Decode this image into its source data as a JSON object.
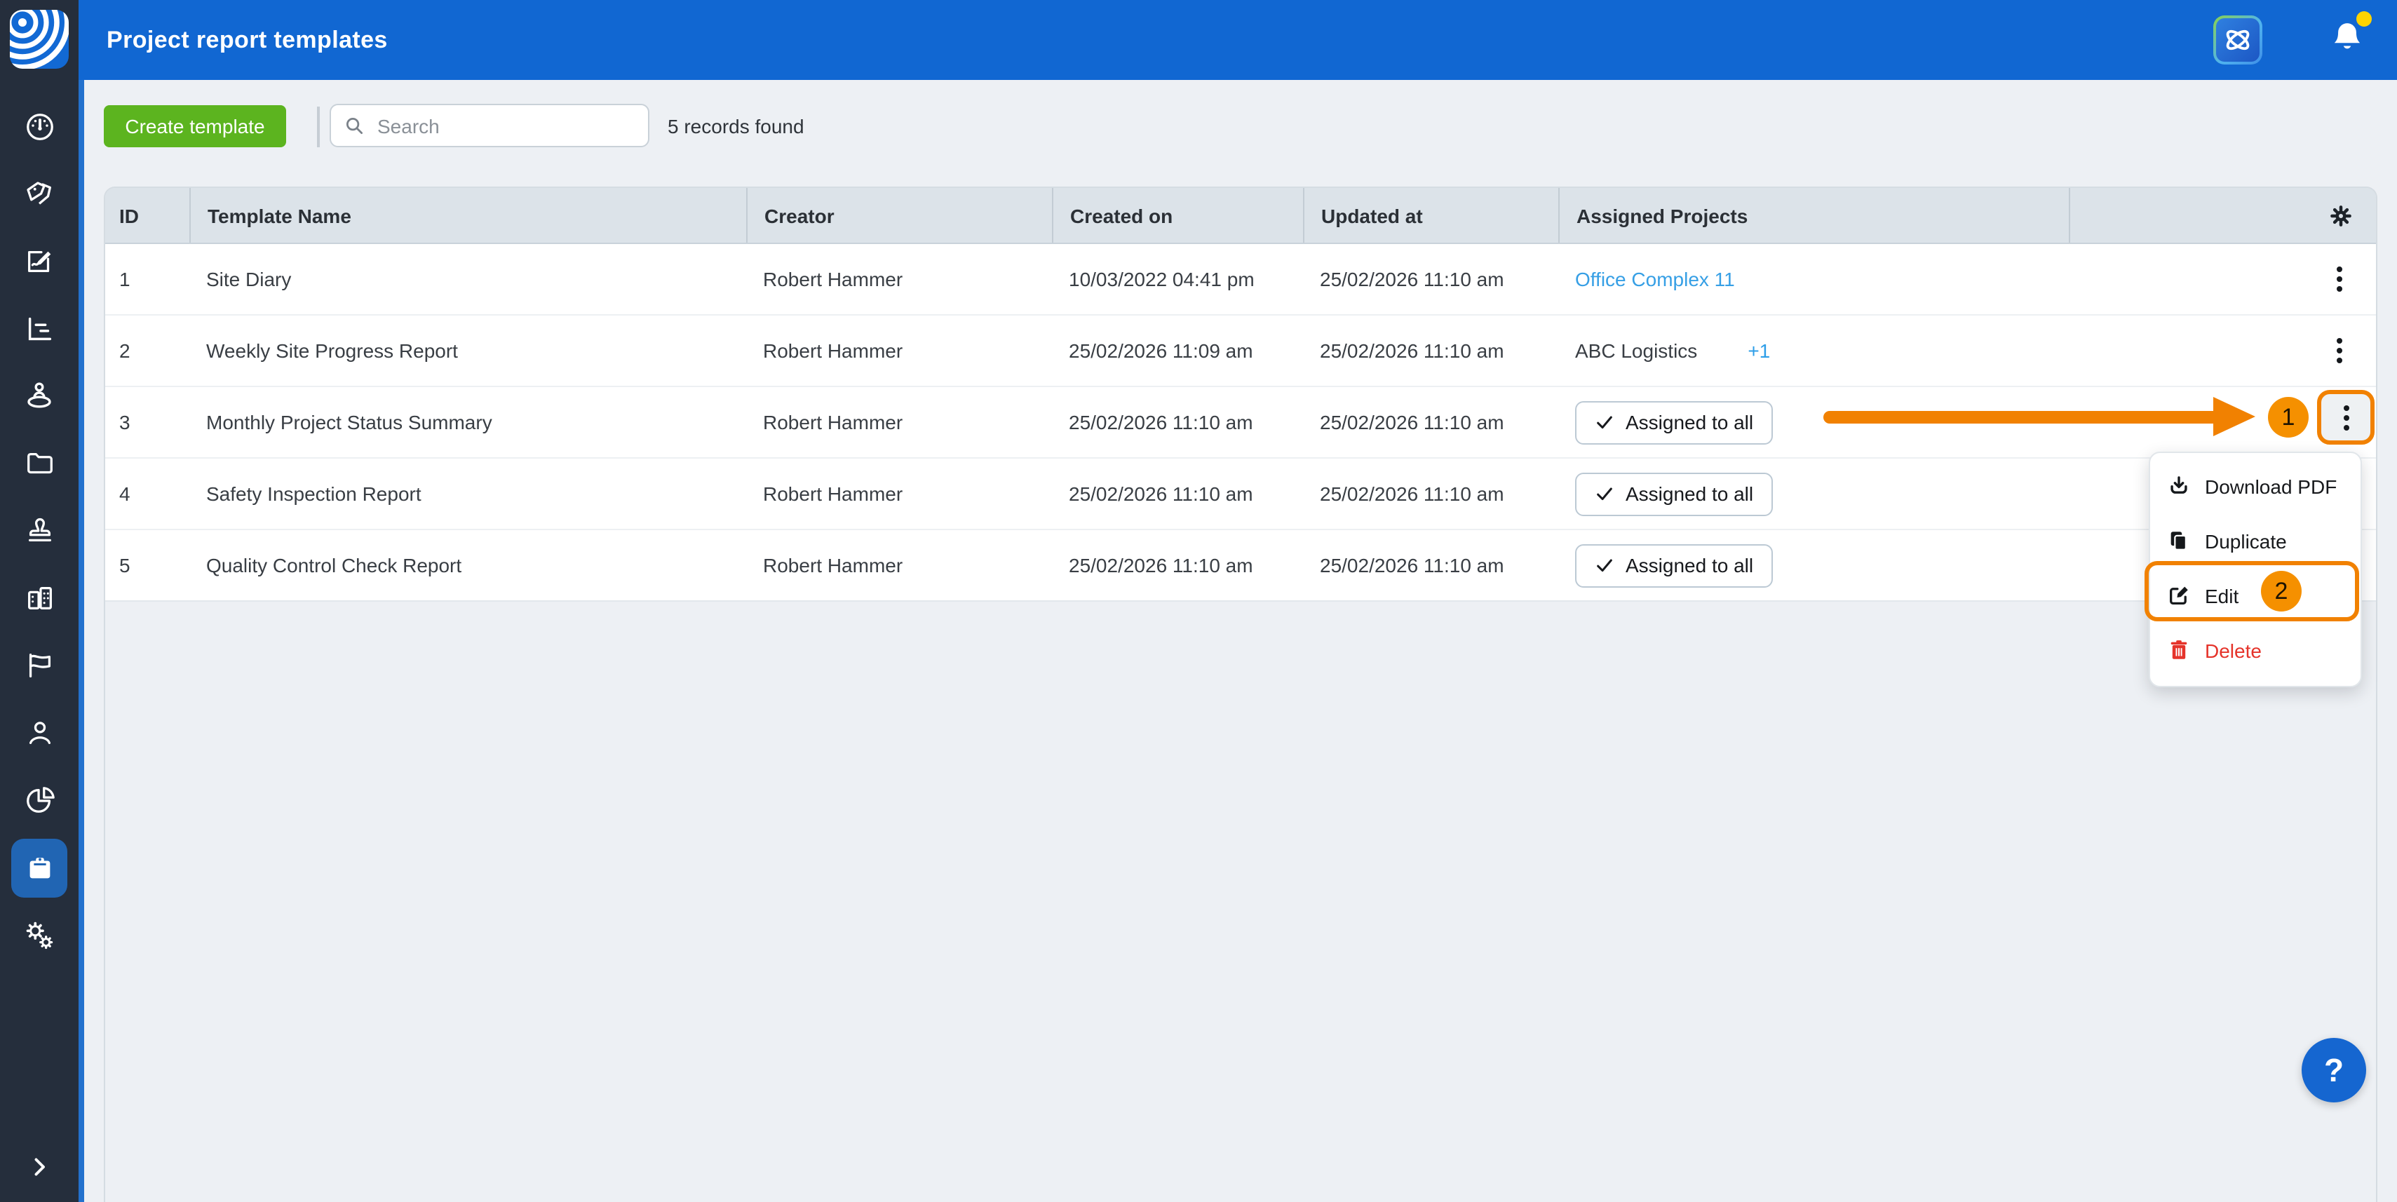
{
  "topbar": {
    "title": "Project report templates"
  },
  "toolbar": {
    "create_label": "Create template",
    "search_placeholder": "Search",
    "records_text": "5 records found"
  },
  "table": {
    "headers": [
      "ID",
      "Template Name",
      "Creator",
      "Created on",
      "Updated at",
      "Assigned Projects"
    ],
    "assigned_chip_label": "Assigned to all",
    "rows": [
      {
        "id": "1",
        "name": "Site Diary",
        "creator": "Robert Hammer",
        "created": "10/03/2022 04:41 pm",
        "updated": "25/02/2026 11:10 am",
        "assigned_link": "Office Complex 11"
      },
      {
        "id": "2",
        "name": "Weekly Site Progress Report",
        "creator": "Robert Hammer",
        "created": "25/02/2026 11:09 am",
        "updated": "25/02/2026 11:10 am",
        "assigned_text": "ABC Logistics",
        "assigned_badge": "+1"
      },
      {
        "id": "3",
        "name": "Monthly Project Status Summary",
        "creator": "Robert Hammer",
        "created": "25/02/2026 11:10 am",
        "updated": "25/02/2026 11:10 am"
      },
      {
        "id": "4",
        "name": "Safety Inspection Report",
        "creator": "Robert Hammer",
        "created": "25/02/2026 11:10 am",
        "updated": "25/02/2026 11:10 am"
      },
      {
        "id": "5",
        "name": "Quality Control Check Report",
        "creator": "Robert Hammer",
        "created": "25/02/2026 11:10 am",
        "updated": "25/02/2026 11:10 am"
      }
    ]
  },
  "menu": {
    "items": [
      {
        "label": "Download PDF",
        "icon": "download-icon"
      },
      {
        "label": "Duplicate",
        "icon": "duplicate-icon"
      },
      {
        "label": "Edit",
        "icon": "edit-icon"
      },
      {
        "label": "Delete",
        "icon": "trash-icon"
      }
    ]
  },
  "annotations": {
    "step1": "1",
    "step2": "2"
  },
  "help": {
    "label": "?"
  },
  "sidebar": {
    "icons": [
      "dashboard-icon",
      "tags-icon",
      "signature-icon",
      "chart-icon",
      "person-pin-icon",
      "folder-icon",
      "stamp-icon",
      "buildings-icon",
      "flag-icon",
      "user-icon",
      "pie-chart-icon",
      "report-templates-icon",
      "settings-gears-icon",
      "collapse-chevron-icon"
    ],
    "active": "report-templates"
  },
  "colors": {
    "topbar_blue": "#1167d2",
    "sidebar_dark": "#252e3c",
    "accent_green": "#5cb41f",
    "link_blue": "#369fe5",
    "annotation_orange": "#f18101",
    "delete_red": "#e5332a",
    "header_bg": "#dce3e9"
  }
}
